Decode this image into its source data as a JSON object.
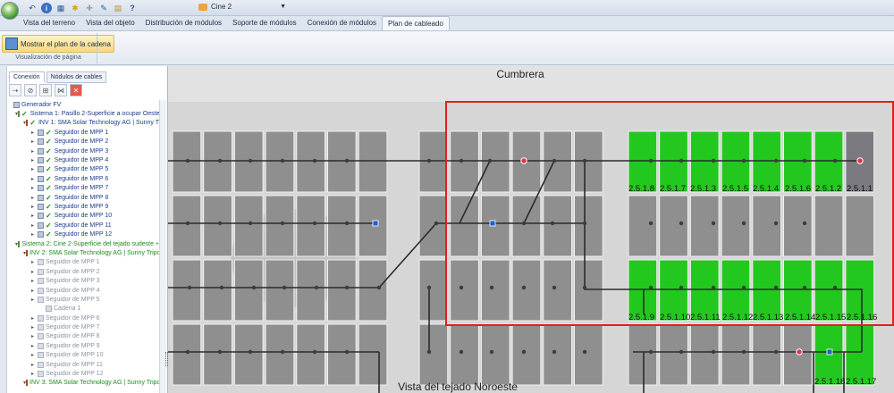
{
  "header": {
    "document_title": "Cine 2",
    "qat_icons": [
      "undo-icon",
      "info-icon",
      "grid-icon",
      "open-icon",
      "settings-icon",
      "tool-icon",
      "print-icon",
      "help-icon"
    ],
    "help_glyph": "?",
    "info_glyph": "i"
  },
  "tabs": [
    {
      "label": "Vista del terreno",
      "active": false
    },
    {
      "label": "Vista del objeto",
      "active": false
    },
    {
      "label": "Distribución de módulos",
      "active": false
    },
    {
      "label": "Soporte de módulos",
      "active": false
    },
    {
      "label": "Conexión de módulos",
      "active": false
    },
    {
      "label": "Plan de cableado",
      "active": true
    }
  ],
  "ribbon": {
    "show_string_plan_label": "Mostrar el plan de la cadena",
    "group_label": "Visualización de página"
  },
  "panel": {
    "tabs": [
      {
        "label": "Conexión",
        "active": true
      },
      {
        "label": "Nódulos de cables",
        "active": false
      }
    ],
    "tree": [
      {
        "level": 0,
        "label": "Generador FV",
        "type": "root",
        "state": "normal"
      },
      {
        "level": 1,
        "label": "Sistema 1:  Pasillo 2-Superficie a ocupar Oeste",
        "type": "sys",
        "state": "normal",
        "check": true
      },
      {
        "level": 2,
        "label": "INV 1: SMA Solar Technology AG | Sunny T",
        "type": "inv",
        "state": "normal",
        "check": true
      },
      {
        "level": 3,
        "label": "Seguidor de MPP 1",
        "type": "mpp",
        "state": "normal",
        "check": true
      },
      {
        "level": 3,
        "label": "Seguidor de MPP 2",
        "type": "mpp",
        "state": "normal",
        "check": true
      },
      {
        "level": 3,
        "label": "Seguidor de MPP 3",
        "type": "mpp",
        "state": "normal",
        "check": true
      },
      {
        "level": 3,
        "label": "Seguidor de MPP 4",
        "type": "mpp",
        "state": "normal",
        "check": true
      },
      {
        "level": 3,
        "label": "Seguidor de MPP 5",
        "type": "mpp",
        "state": "normal",
        "check": true
      },
      {
        "level": 3,
        "label": "Seguidor de MPP 6",
        "type": "mpp",
        "state": "normal",
        "check": true
      },
      {
        "level": 3,
        "label": "Seguidor de MPP 7",
        "type": "mpp",
        "state": "normal",
        "check": true
      },
      {
        "level": 3,
        "label": "Seguidor de MPP 8",
        "type": "mpp",
        "state": "normal",
        "check": true
      },
      {
        "level": 3,
        "label": "Seguidor de MPP 9",
        "type": "mpp",
        "state": "normal",
        "check": true
      },
      {
        "level": 3,
        "label": "Seguidor de MPP 10",
        "type": "mpp",
        "state": "normal",
        "check": true
      },
      {
        "level": 3,
        "label": "Seguidor de MPP 11",
        "type": "mpp",
        "state": "normal",
        "check": true
      },
      {
        "level": 3,
        "label": "Seguidor de MPP 12",
        "type": "mpp",
        "state": "normal",
        "check": true
      },
      {
        "level": 1,
        "label": "Sistema 2:  Cine 2-Superficie del tejado sudeste +",
        "type": "sys",
        "state": "green",
        "check": false
      },
      {
        "level": 2,
        "label": "INV 2: SMA Solar Technology AG | Sunny Tripo",
        "type": "inv",
        "state": "green",
        "check": false
      },
      {
        "level": 3,
        "label": "Seguidor de MPP 1",
        "type": "mpp",
        "state": "grey",
        "check": false
      },
      {
        "level": 3,
        "label": "Seguidor de MPP 2",
        "type": "mpp",
        "state": "grey",
        "check": false
      },
      {
        "level": 3,
        "label": "Seguidor de MPP 3",
        "type": "mpp",
        "state": "grey",
        "check": false
      },
      {
        "level": 3,
        "label": "Seguidor de MPP 4",
        "type": "mpp",
        "state": "grey",
        "check": false
      },
      {
        "level": 3,
        "label": "Seguidor de MPP 5",
        "type": "mpp",
        "state": "grey",
        "check": false
      },
      {
        "level": 4,
        "label": "Cadena 1",
        "type": "string",
        "state": "grey",
        "check": false
      },
      {
        "level": 3,
        "label": "Seguidor de MPP 6",
        "type": "mpp",
        "state": "grey",
        "check": false
      },
      {
        "level": 3,
        "label": "Seguidor de MPP 7",
        "type": "mpp",
        "state": "grey",
        "check": false
      },
      {
        "level": 3,
        "label": "Seguidor de MPP 8",
        "type": "mpp",
        "state": "grey",
        "check": false
      },
      {
        "level": 3,
        "label": "Seguidor de MPP 9",
        "type": "mpp",
        "state": "grey",
        "check": false
      },
      {
        "level": 3,
        "label": "Seguidor de MPP 10",
        "type": "mpp",
        "state": "grey",
        "check": false
      },
      {
        "level": 3,
        "label": "Seguidor de MPP 11",
        "type": "mpp",
        "state": "grey",
        "check": false
      },
      {
        "level": 3,
        "label": "Seguidor de MPP 12",
        "type": "mpp",
        "state": "grey",
        "check": false
      },
      {
        "level": 2,
        "label": "INV 3: SMA Solar Technology AG | Sunny Tripo",
        "type": "inv",
        "state": "green",
        "check": false
      }
    ]
  },
  "canvas": {
    "title_top": "Cumbrera",
    "title_bottom": "Vista del tejado Noroeste",
    "module_labels_row1": [
      "2.5.1.8",
      "2.5.1.7",
      "2.5.1.3",
      "2.5.1.5",
      "2.5.1.4",
      "2.5.1.6",
      "2.5.1.2",
      "2.5.1.1"
    ],
    "module_labels_row3": [
      "2.5.1.9",
      "2.5.1.10",
      "2.5.1.11",
      "2.5.1.12",
      "2.5.1.13",
      "2.5.1.14",
      "2.5.1.15",
      "2.5.1.16"
    ],
    "module_labels_row4": [
      "2.5.1.18",
      "2.5.1.17"
    ],
    "colors": {
      "module_grey": "#8f8f8f",
      "module_green": "#22c81e",
      "selection_red": "#e02020",
      "wire": "#2b2b2b",
      "marker_blue": "#1e5fd8",
      "marker_red": "#e0344a"
    }
  }
}
